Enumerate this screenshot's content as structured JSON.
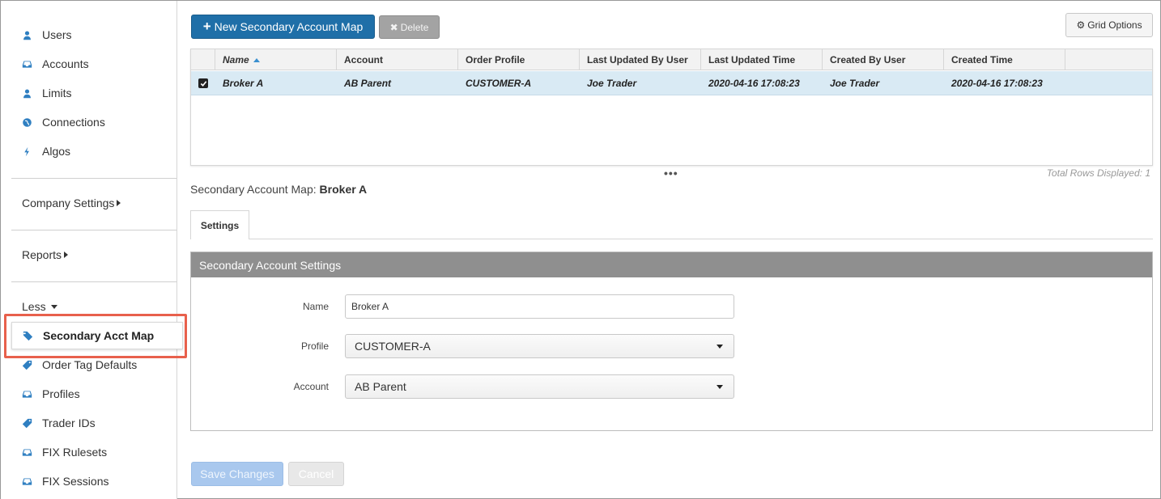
{
  "sidebar": {
    "items": [
      {
        "label": "Users",
        "icon": "user-icon"
      },
      {
        "label": "Accounts",
        "icon": "inbox-icon"
      },
      {
        "label": "Limits",
        "icon": "user-icon"
      },
      {
        "label": "Connections",
        "icon": "globe-icon"
      },
      {
        "label": "Algos",
        "icon": "bolt-icon"
      }
    ],
    "company_settings": "Company Settings",
    "reports": "Reports",
    "less": "Less",
    "active": {
      "label": "Secondary Acct Map",
      "icon": "tags-icon"
    },
    "more_items": [
      {
        "label": "Order Tag Defaults",
        "icon": "tag-icon"
      },
      {
        "label": "Profiles",
        "icon": "inbox-icon"
      },
      {
        "label": "Trader IDs",
        "icon": "tag-icon"
      },
      {
        "label": "FIX Rulesets",
        "icon": "inbox-icon"
      },
      {
        "label": "FIX Sessions",
        "icon": "inbox-icon"
      }
    ]
  },
  "toolbar": {
    "new_label": "New Secondary Account Map",
    "delete_label": "Delete",
    "grid_options_label": "Grid Options"
  },
  "grid": {
    "columns": [
      "Name",
      "Account",
      "Order Profile",
      "Last Updated By User",
      "Last Updated Time",
      "Created By User",
      "Created Time"
    ],
    "rows": [
      [
        "Broker A",
        "AB Parent",
        "CUSTOMER-A",
        "Joe Trader",
        "2020-04-16 17:08:23",
        "Joe Trader",
        "2020-04-16 17:08:23"
      ]
    ],
    "total_rows_text": "Total Rows Displayed: 1",
    "more_dots": "•••"
  },
  "detail": {
    "title_prefix": "Secondary Account Map:",
    "title_value": "Broker A",
    "tab_label": "Settings",
    "panel_title": "Secondary Account Settings",
    "fields": {
      "name_label": "Name",
      "name_value": "Broker A",
      "profile_label": "Profile",
      "profile_value": "CUSTOMER-A",
      "account_label": "Account",
      "account_value": "AB Parent"
    },
    "save_label": "Save Changes",
    "cancel_label": "Cancel"
  },
  "colors": {
    "accent": "#1f6fa8",
    "highlight": "#e8604c",
    "selected_row": "#d9eaf4",
    "panel_header": "#8f8f8f"
  }
}
